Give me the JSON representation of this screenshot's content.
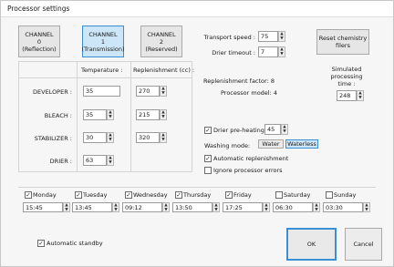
{
  "window": {
    "title": "Processor settings"
  },
  "channels": [
    {
      "line1": "CHANNEL",
      "line2": "0",
      "line3": "(Reflection)",
      "active": false
    },
    {
      "line1": "CHANNEL",
      "line2": "1",
      "line3": "(Transmission)",
      "active": true
    },
    {
      "line1": "CHANNEL",
      "line2": "2",
      "line3": "(Reserved)",
      "active": false
    }
  ],
  "table": {
    "col_temperature": "Temperature :",
    "col_replenishment": "Replenishment (cc) :",
    "rows": [
      {
        "label": "DEVELOPER :",
        "temperature": "35",
        "replenishment": "270"
      },
      {
        "label": "BLEACH :",
        "temperature": "35",
        "replenishment": "215"
      },
      {
        "label": "STABILIZER :",
        "temperature": "30",
        "replenishment": "320"
      },
      {
        "label": "DRIER :",
        "temperature": "63",
        "replenishment": ""
      }
    ]
  },
  "transport": {
    "speed_label": "Transport speed :",
    "speed_value": "75",
    "timeout_label": "Drier timeout :",
    "timeout_value": "7"
  },
  "reset_button": {
    "line1": "Reset chemistry",
    "line2": "filers"
  },
  "info": {
    "replenishment_factor": "Replenishment factor: 8",
    "processor_model": "Processor model: 4"
  },
  "simulated": {
    "label_line1": "Simulated",
    "label_line2": "processing",
    "label_line3": "time :",
    "value": "248"
  },
  "drier_preheating": {
    "label": "Drier pre-heating",
    "checked": true,
    "value": "45"
  },
  "washing": {
    "label": "Washing mode:",
    "options": [
      "Water",
      "Waterless"
    ],
    "selected": "Waterless"
  },
  "auto_replenishment": {
    "label": "Automatic replenishment",
    "checked": true
  },
  "ignore_errors": {
    "label": "Ignore processor errors",
    "checked": false
  },
  "days": [
    {
      "name": "Monday",
      "checked": true,
      "time": "15:45"
    },
    {
      "name": "Tuesday",
      "checked": true,
      "time": "13:45"
    },
    {
      "name": "Wednesday",
      "checked": true,
      "time": "09:12"
    },
    {
      "name": "Thursday",
      "checked": true,
      "time": "13:50"
    },
    {
      "name": "Friday",
      "checked": true,
      "time": "17:25"
    },
    {
      "name": "Saturday",
      "checked": false,
      "time": "06:30"
    },
    {
      "name": "Sunday",
      "checked": false,
      "time": "03:30"
    }
  ],
  "auto_standby": {
    "label": "Automatic standby",
    "checked": true
  },
  "ok_label": "OK",
  "cancel_label": "Cancel"
}
